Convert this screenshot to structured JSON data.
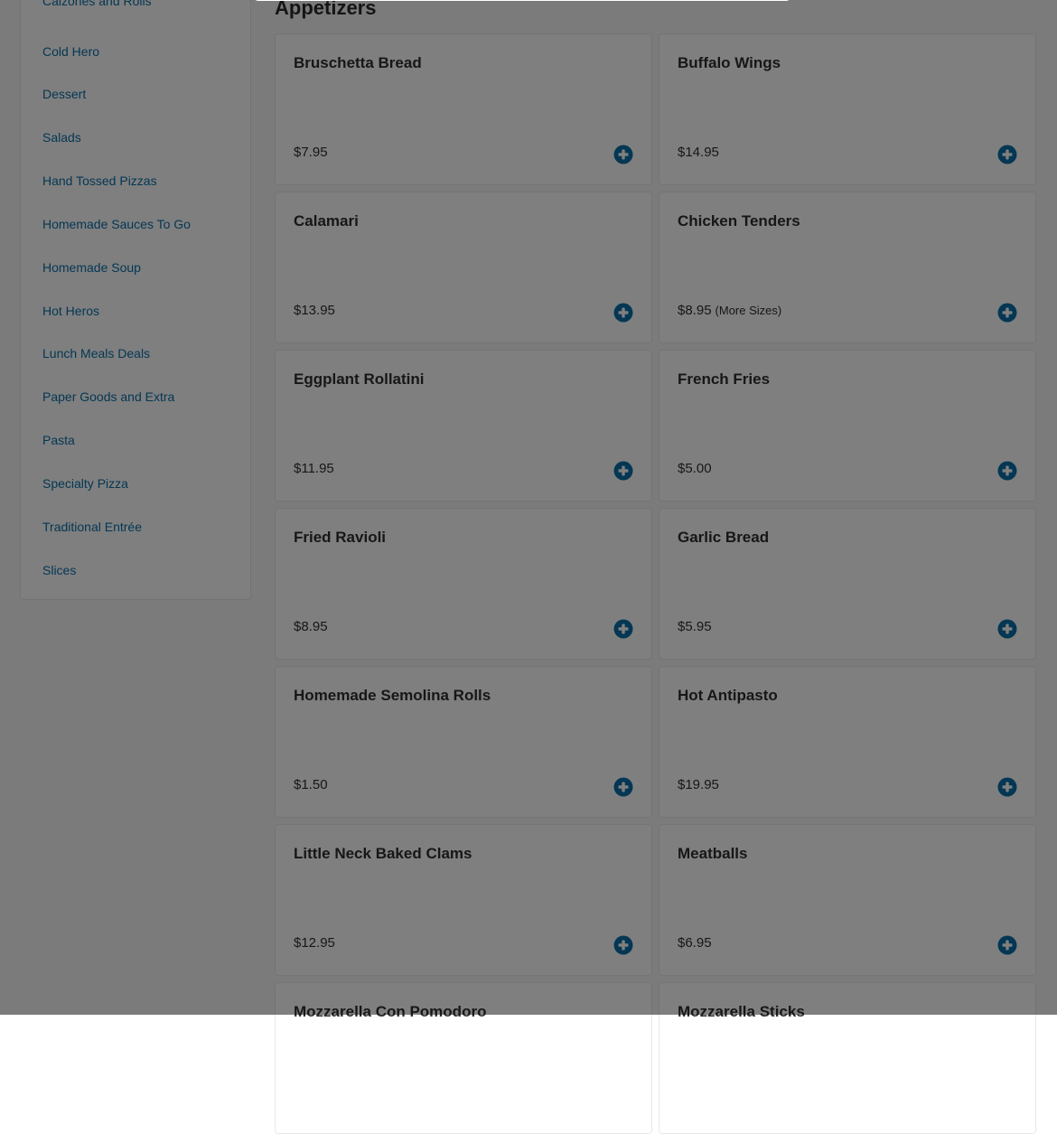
{
  "sidebar": {
    "items": [
      {
        "label": "Calzones and Rolls"
      },
      {
        "label": "Cold Hero"
      },
      {
        "label": "Dessert"
      },
      {
        "label": "Salads"
      },
      {
        "label": "Hand Tossed Pizzas"
      },
      {
        "label": "Homemade Sauces To Go"
      },
      {
        "label": "Homemade Soup"
      },
      {
        "label": "Hot Heros"
      },
      {
        "label": "Lunch Meals Deals"
      },
      {
        "label": "Paper Goods and Extra"
      },
      {
        "label": "Pasta"
      },
      {
        "label": "Specialty Pizza"
      },
      {
        "label": "Traditional Entrée"
      },
      {
        "label": "Slices"
      }
    ]
  },
  "main": {
    "section_title": "Appetizers",
    "items": [
      {
        "name": "Bruschetta Bread",
        "price": "$7.95",
        "sizes": ""
      },
      {
        "name": "Buffalo Wings",
        "price": "$14.95",
        "sizes": ""
      },
      {
        "name": "Calamari",
        "price": "$13.95",
        "sizes": ""
      },
      {
        "name": "Chicken Tenders",
        "price": "$8.95",
        "sizes": "(More Sizes)"
      },
      {
        "name": "Eggplant Rollatini",
        "price": "$11.95",
        "sizes": ""
      },
      {
        "name": "French Fries",
        "price": "$5.00",
        "sizes": ""
      },
      {
        "name": "Fried Ravioli",
        "price": "$8.95",
        "sizes": ""
      },
      {
        "name": "Garlic Bread",
        "price": "$5.95",
        "sizes": ""
      },
      {
        "name": "Homemade Semolina Rolls",
        "price": "$1.50",
        "sizes": ""
      },
      {
        "name": "Hot Antipasto",
        "price": "$19.95",
        "sizes": ""
      },
      {
        "name": "Little Neck Baked Clams",
        "price": "$12.95",
        "sizes": ""
      },
      {
        "name": "Meatballs",
        "price": "$6.95",
        "sizes": ""
      },
      {
        "name": "Mozzarella Con Pomodoro",
        "price": "",
        "sizes": ""
      },
      {
        "name": "Mozzarella Sticks",
        "price": "",
        "sizes": ""
      }
    ]
  },
  "icons": {
    "add": "plus-circle-icon"
  },
  "colors": {
    "accent": "#0b6fa8",
    "overlay": "rgba(0,0,0,0.5)"
  }
}
